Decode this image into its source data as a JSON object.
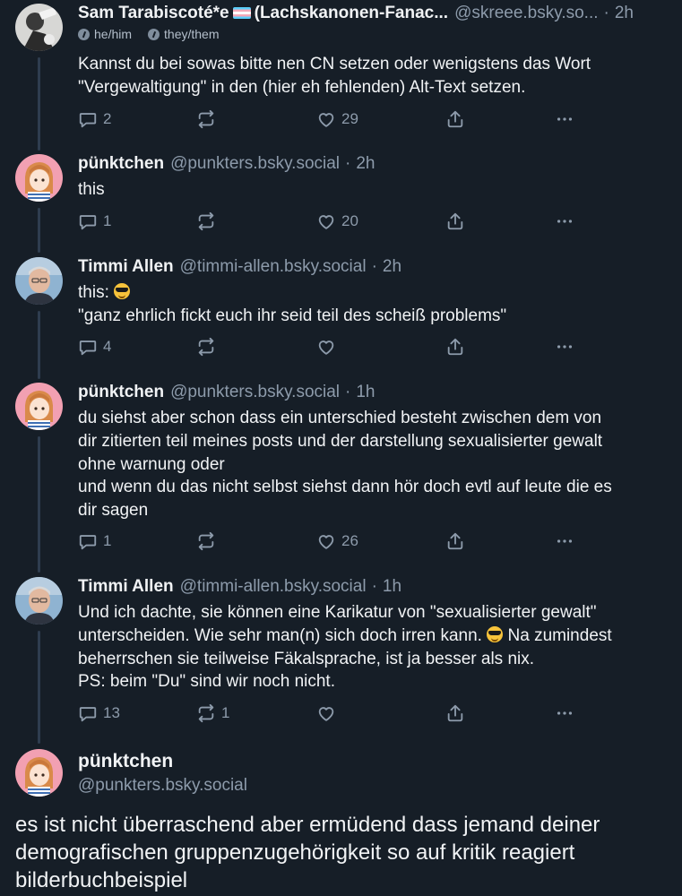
{
  "posts": [
    {
      "name": "Sam Tarabiscoté*e",
      "name_suffix": "(Lachskanonen-Fanac...",
      "handle": "@skreee.bsky.so...",
      "time": "2h",
      "pronouns": [
        "he/him",
        "they/them"
      ],
      "lines": [
        "Kannst du bei sowas bitte nen CN setzen oder wenigstens das Wort",
        "\"Vergewaltigung\" in den (hier eh fehlenden) Alt-Text setzen."
      ],
      "replies": "2",
      "reposts": "",
      "likes": "29"
    },
    {
      "name": "pünktchen",
      "handle": "@punkters.bsky.social",
      "time": "2h",
      "lines": [
        "this"
      ],
      "replies": "1",
      "reposts": "",
      "likes": "20"
    },
    {
      "name": "Timmi Allen",
      "handle": "@timmi-allen.bsky.social",
      "time": "2h",
      "lines": [
        "this: ",
        "\"ganz ehrlich fickt euch ihr seid teil des scheiß problems\""
      ],
      "replies": "4",
      "reposts": "",
      "likes": ""
    },
    {
      "name": "pünktchen",
      "handle": "@punkters.bsky.social",
      "time": "1h",
      "lines": [
        "du siehst aber schon dass ein unterschied besteht zwischen dem von",
        "dir zitierten teil meines posts und der darstellung sexualisierter gewalt",
        "ohne warnung oder",
        "und wenn du das nicht selbst siehst dann hör doch evtl auf leute die es",
        "dir sagen"
      ],
      "replies": "1",
      "reposts": "",
      "likes": "26"
    },
    {
      "name": "Timmi Allen",
      "handle": "@timmi-allen.bsky.social",
      "time": "1h",
      "lines": [
        "Und ich dachte, sie können eine Karikatur von \"sexualisierter gewalt\"",
        "unterscheiden. Wie sehr man(n) sich doch irren kann. ",
        " Na zumindest",
        "beherrschen sie teilweise Fäkalsprache, ist ja besser als nix.",
        "PS: beim \"Du\" sind wir noch nicht."
      ],
      "replies": "13",
      "reposts": "1",
      "likes": ""
    }
  ],
  "focused": {
    "name": "pünktchen",
    "handle": "@punkters.bsky.social",
    "lines": [
      "es ist nicht überraschend aber ermüdend dass jemand deiner",
      "demografischen gruppenzugehörigkeit so auf kritik reagiert",
      "bilderbuchbeispiel"
    ]
  },
  "dot": "·",
  "icons": [
    "reply-icon",
    "repost-icon",
    "like-icon",
    "share-icon",
    "more-icon"
  ],
  "colors": {
    "background": "#161e27",
    "muted": "#8d9bab",
    "thread_line": "#2e3d4f"
  }
}
